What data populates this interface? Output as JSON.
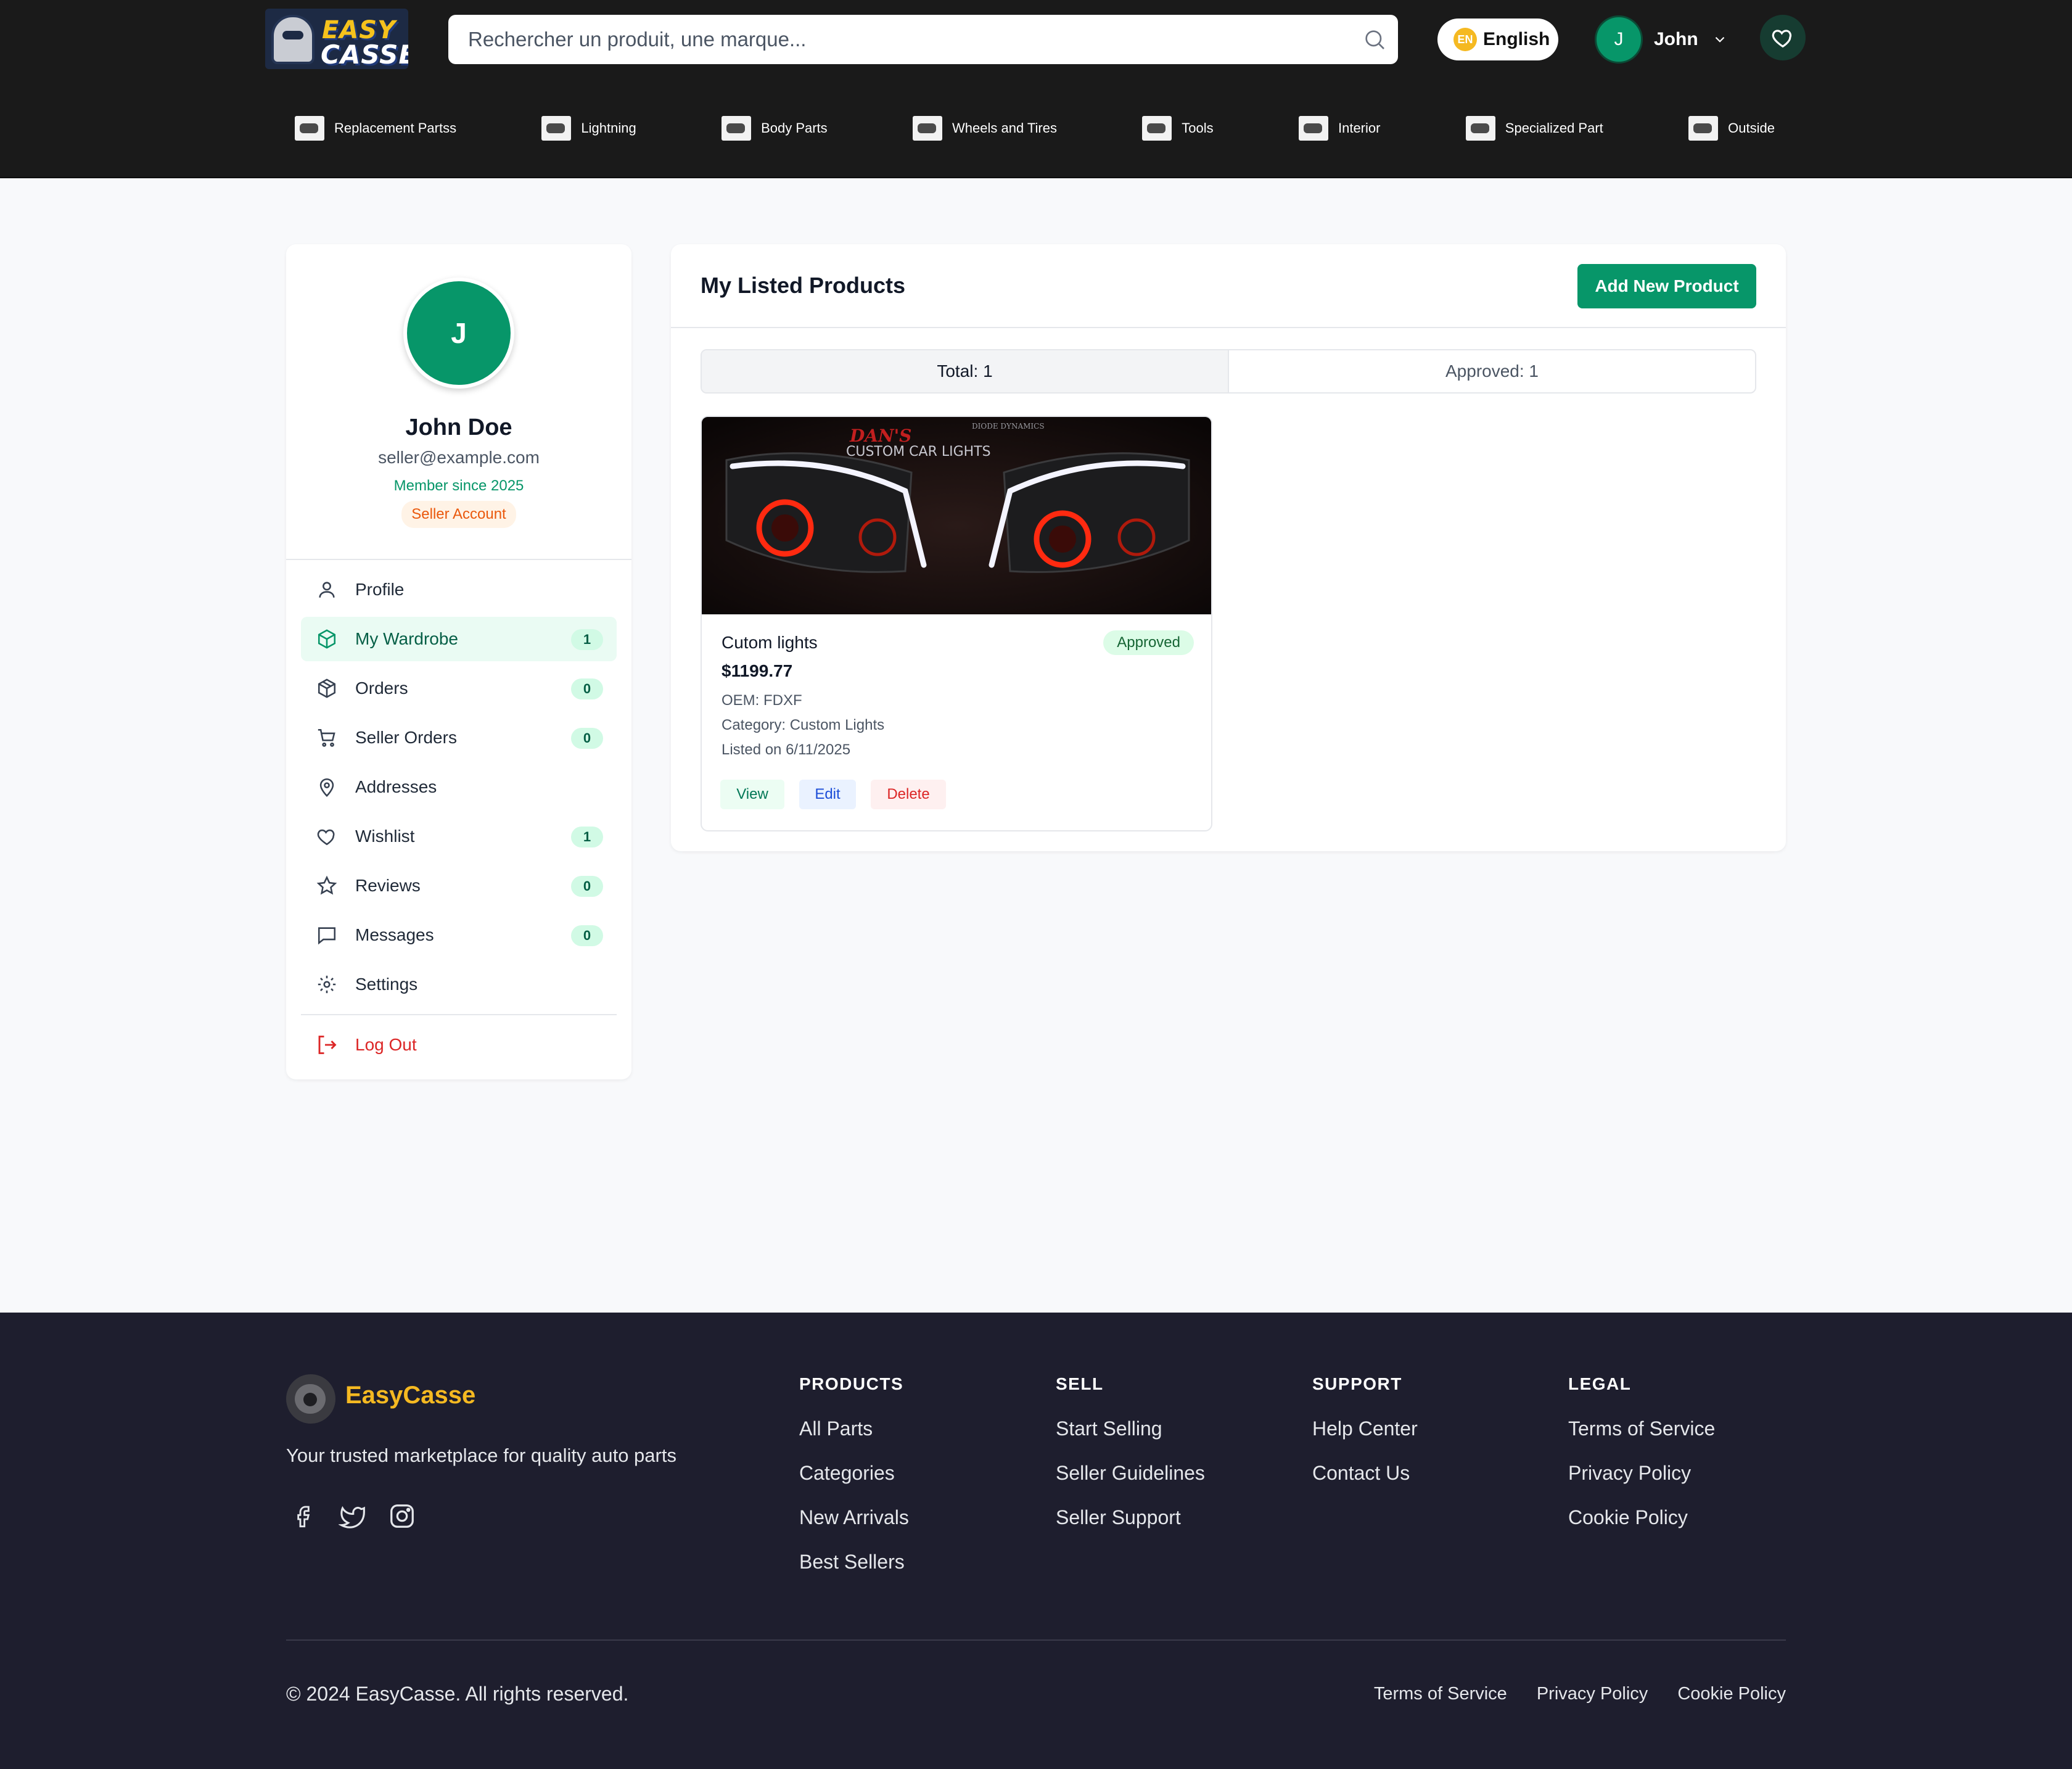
{
  "header": {
    "logo_line1": "EASY",
    "logo_line2": "CASSE",
    "search_placeholder": "Rechercher un produit, une marque...",
    "language_code": "EN",
    "language_label": "English",
    "user_initial": "J",
    "user_name": "John",
    "categories": [
      {
        "label": "Replacement Partss",
        "icon": "engine-part-thumb"
      },
      {
        "label": "Lightning",
        "icon": "headlight-thumb"
      },
      {
        "label": "Body Parts",
        "icon": "body-panel-thumb"
      },
      {
        "label": "Wheels and Tires",
        "icon": "wheel-thumb"
      },
      {
        "label": "Tools",
        "icon": "tools-thumb"
      },
      {
        "label": "Interior",
        "icon": "seat-thumb"
      },
      {
        "label": "Specialized Part",
        "icon": "specialized-part-thumb"
      },
      {
        "label": "Outside",
        "icon": "car-exterior-thumb"
      }
    ]
  },
  "profile": {
    "initial": "J",
    "name": "John Doe",
    "email": "seller@example.com",
    "member_since": "Member since 2025",
    "account_type": "Seller Account"
  },
  "menu": [
    {
      "label": "Profile",
      "icon": "user-icon",
      "count": null
    },
    {
      "label": "My Wardrobe",
      "icon": "package-icon",
      "count": "1",
      "active": true
    },
    {
      "label": "Orders",
      "icon": "box-icon",
      "count": "0"
    },
    {
      "label": "Seller Orders",
      "icon": "cart-icon",
      "count": "0"
    },
    {
      "label": "Addresses",
      "icon": "map-pin-icon",
      "count": null
    },
    {
      "label": "Wishlist",
      "icon": "heart-icon",
      "count": "1"
    },
    {
      "label": "Reviews",
      "icon": "star-icon",
      "count": "0"
    },
    {
      "label": "Messages",
      "icon": "message-icon",
      "count": "0"
    },
    {
      "label": "Settings",
      "icon": "gear-icon",
      "count": null
    }
  ],
  "logout_label": "Log Out",
  "main": {
    "title": "My Listed Products",
    "add_button": "Add New Product",
    "tabs": [
      "Total: 1",
      "Approved: 1"
    ],
    "product": {
      "image_caption": "DAN'S",
      "image_sub": "CUSTOM CAR LIGHTS",
      "image_brand": "DIODE DYNAMICS",
      "name": "Cutom lights",
      "status": "Approved",
      "price": "$1199.77",
      "oem": "OEM: FDXF",
      "category": "Category: Custom Lights",
      "listed": "Listed on 6/11/2025",
      "actions": [
        "View",
        "Edit",
        "Delete"
      ]
    }
  },
  "footer": {
    "brand": "EasyCasse",
    "tagline": "Your trusted marketplace for quality auto parts",
    "columns": [
      {
        "title": "PRODUCTS",
        "links": [
          "All Parts",
          "Categories",
          "New Arrivals",
          "Best Sellers"
        ]
      },
      {
        "title": "SELL",
        "links": [
          "Start Selling",
          "Seller Guidelines",
          "Seller Support"
        ]
      },
      {
        "title": "SUPPORT",
        "links": [
          "Help Center",
          "Contact Us"
        ]
      },
      {
        "title": "LEGAL",
        "links": [
          "Terms of Service",
          "Privacy Policy",
          "Cookie Policy"
        ]
      }
    ],
    "copyright": "© 2024 EasyCasse. All rights reserved.",
    "legal_links": [
      "Terms of Service",
      "Privacy Policy",
      "Cookie Policy"
    ]
  },
  "colors": {
    "brand_green": "#079669",
    "header_bg": "#1a1a1a",
    "footer_bg": "#1e1e2e",
    "brand_yellow": "#f5b921",
    "danger": "#dc2626"
  }
}
